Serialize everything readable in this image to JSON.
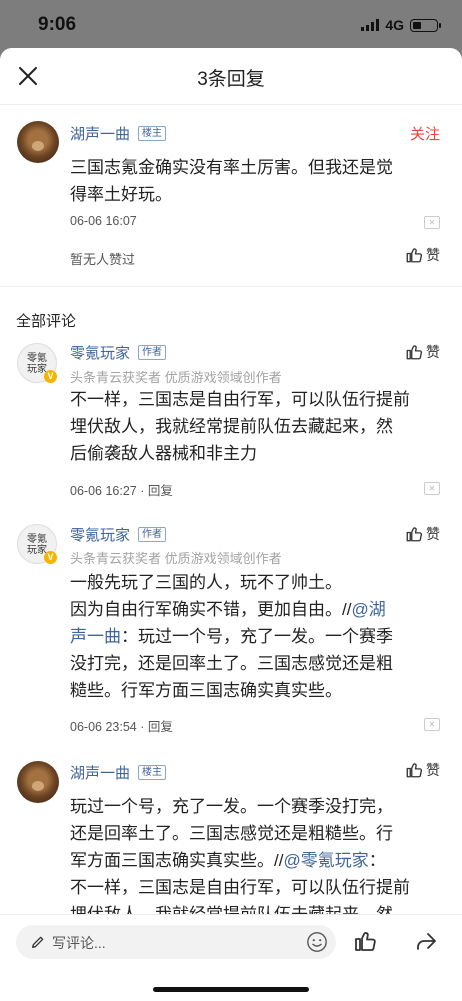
{
  "status": {
    "time": "9:06",
    "network": "4G",
    "battery_fraction": 0.4
  },
  "header": {
    "title": "3条回复"
  },
  "main_comment": {
    "author": "湖声一曲",
    "badge": "楼主",
    "follow": "关注",
    "text": "三国志氪金确实没有率土厉害。但我还是觉得率土好玩。",
    "line1": "三国志氪金确实没有率土厉害。但我还是觉",
    "line2": "得率土好玩。",
    "time": "06-06 16:07",
    "likes_text": "暂无人赞过",
    "like_label": "赞"
  },
  "section_title": "全部评论",
  "replies": [
    {
      "author": "零氪玩家",
      "badge": "作者",
      "subtitle": "头条青云获奖者 优质游戏领域创作者",
      "avatar_text": "零氪玩家",
      "lines": [
        "不一样，三国志是自由行军，可以队伍行提前",
        "埋伏敌人，我就经常提前队伍去藏起来，然",
        "后偷袭敌人器械和非主力"
      ],
      "meta": "06-06 16:27 · 回复",
      "like_label": "赞"
    },
    {
      "author": "零氪玩家",
      "badge": "作者",
      "subtitle": "头条青云获奖者 优质游戏领域创作者",
      "avatar_text": "零氪玩家",
      "line1": "一般先玩了三国的人，玩不了帅土。",
      "line2_pre": "因为自由行军确实不错，更加自由。//",
      "line2_at": "@湖",
      "line3_at": "声一曲",
      "line3_post": "：玩过一个号，充了一发。一个赛季",
      "line4": "没打完，还是回率土了。三国志感觉还是粗",
      "line5": "糙些。行军方面三国志确实真实些。",
      "meta": "06-06 23:54 · 回复",
      "like_label": "赞"
    },
    {
      "author": "湖声一曲",
      "badge": "楼主",
      "line1": "玩过一个号，充了一发。一个赛季没打完，",
      "line2": "还是回率土了。三国志感觉还是粗糙些。行",
      "line3_pre": "军方面三国志确实真实些。//",
      "line3_at": "@零氪玩家",
      "line3_post": "：",
      "line4": "不一样，三国志是自由行军，可以队伍行提前",
      "line5": "埋伏敌人，我就经常提前队伍去藏起来，然",
      "like_label": "赞"
    }
  ],
  "bottom_bar": {
    "placeholder": "写评论..."
  }
}
